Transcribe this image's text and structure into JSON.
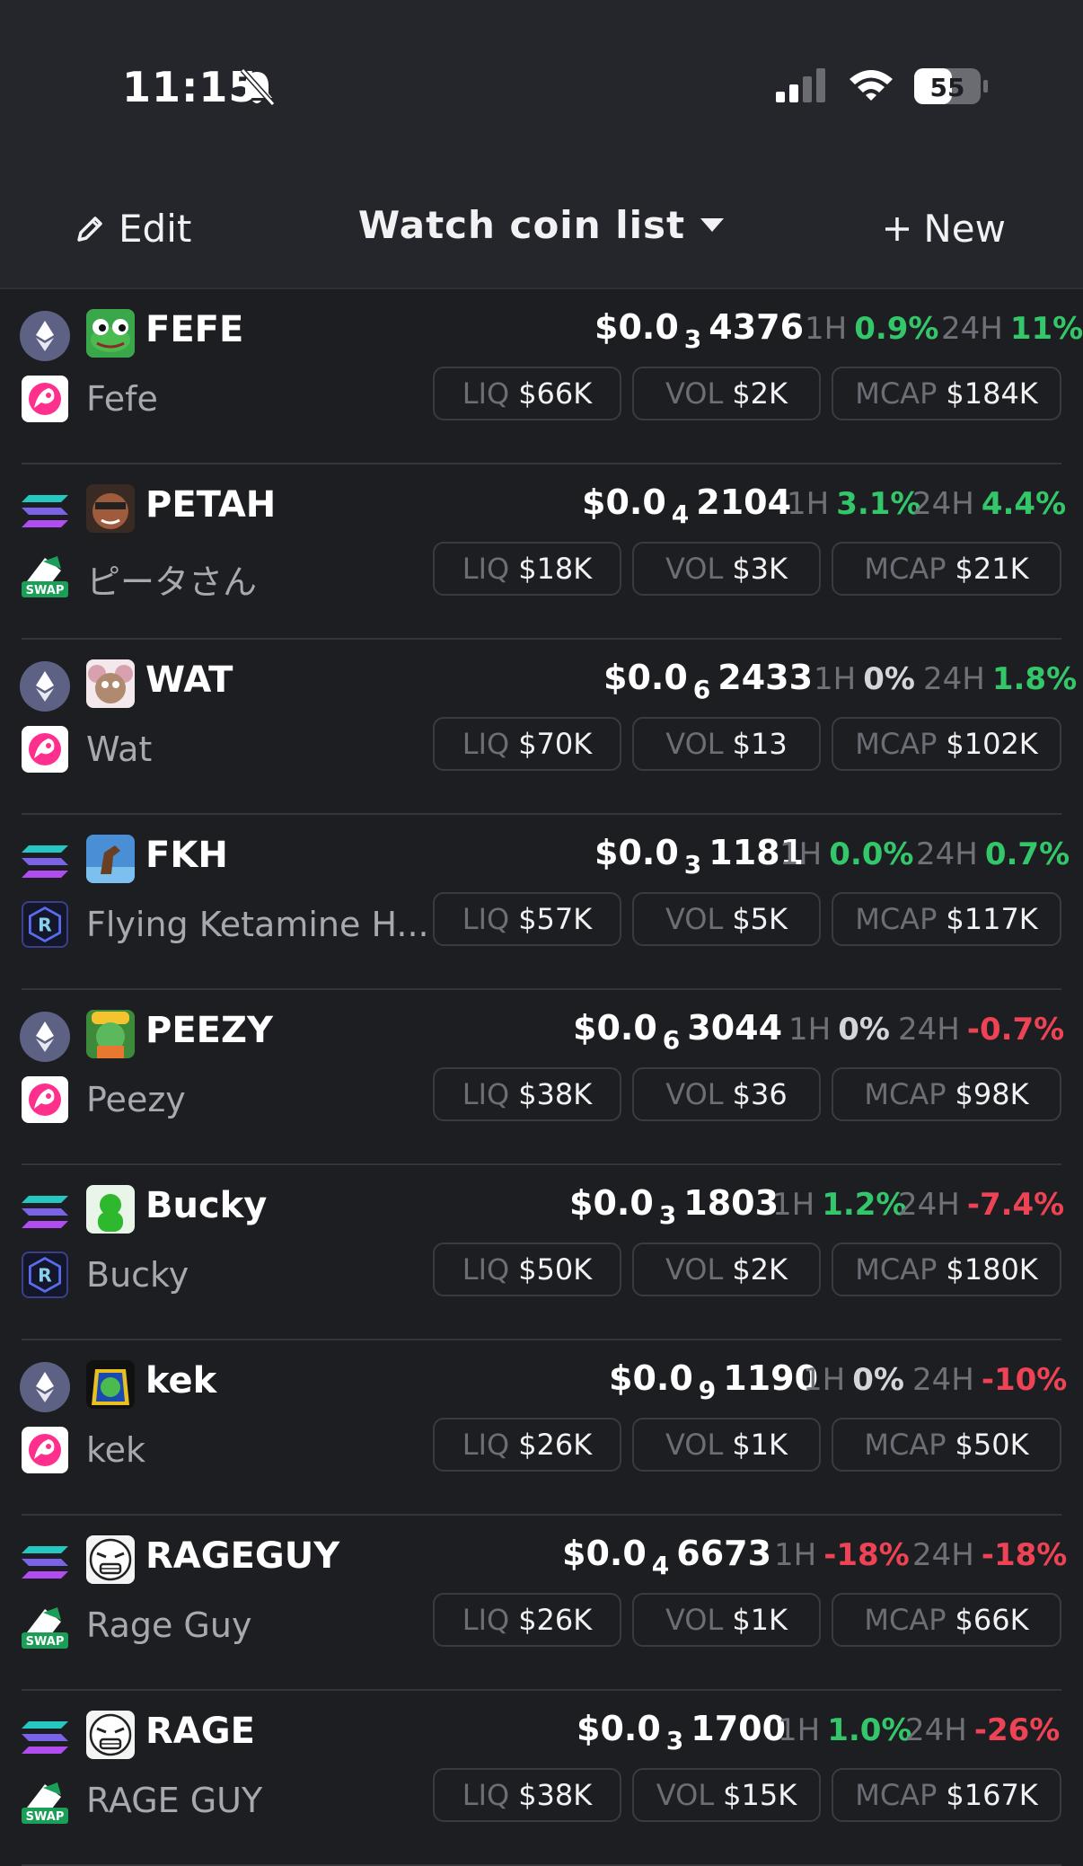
{
  "status_bar": {
    "time": "11:15",
    "battery": "55"
  },
  "header": {
    "edit_label": "Edit",
    "title": "Watch coin list",
    "new_label": "New"
  },
  "labels": {
    "liq": "LIQ",
    "vol": "VOL",
    "mcap": "MCAP",
    "h1": "1H",
    "h24": "24H"
  },
  "colors": {
    "positive": "#34c76a",
    "negative": "#ee4355",
    "background": "#1d1e22"
  },
  "coins": [
    {
      "symbol": "FEFE",
      "name": "Fefe",
      "chain": "ethereum",
      "dex": "uniswap",
      "price_prefix": "$0.0",
      "price_zeros": "3",
      "price_digits": "4376",
      "h1": "0.9%",
      "h1_dir": "pos",
      "h24": "11%",
      "h24_dir": "pos",
      "liq": "$66K",
      "vol": "$2K",
      "mcap": "$184K",
      "logo": "frog-icon"
    },
    {
      "symbol": "PETAH",
      "name": "ピータさん",
      "chain": "solana",
      "dex": "swap",
      "price_prefix": "$0.0",
      "price_zeros": "4",
      "price_digits": "2104",
      "h1": "3.1%",
      "h1_dir": "pos",
      "h24": "4.4%",
      "h24_dir": "pos",
      "liq": "$18K",
      "vol": "$3K",
      "mcap": "$21K",
      "logo": "face-icon"
    },
    {
      "symbol": "WAT",
      "name": "Wat",
      "chain": "ethereum",
      "dex": "uniswap",
      "price_prefix": "$0.0",
      "price_zeros": "6",
      "price_digits": "2433",
      "h1": "0%",
      "h1_dir": "zero",
      "h24": "1.8%",
      "h24_dir": "pos",
      "liq": "$70K",
      "vol": "$13",
      "mcap": "$102K",
      "logo": "mouse-icon"
    },
    {
      "symbol": "FKH",
      "name": "Flying Ketamine H...",
      "chain": "solana",
      "dex": "raydium",
      "price_prefix": "$0.0",
      "price_zeros": "3",
      "price_digits": "1181",
      "h1": "0.0%",
      "h1_dir": "pos",
      "h24": "0.7%",
      "h24_dir": "pos",
      "liq": "$57K",
      "vol": "$5K",
      "mcap": "$117K",
      "logo": "horse-icon"
    },
    {
      "symbol": "PEEZY",
      "name": "Peezy",
      "chain": "ethereum",
      "dex": "uniswap",
      "price_prefix": "$0.0",
      "price_zeros": "6",
      "price_digits": "3044",
      "h1": "0%",
      "h1_dir": "zero",
      "h24": "-0.7%",
      "h24_dir": "neg",
      "liq": "$38K",
      "vol": "$36",
      "mcap": "$98K",
      "logo": "frog-hat-icon"
    },
    {
      "symbol": "Bucky",
      "name": "Bucky",
      "chain": "solana",
      "dex": "raydium",
      "price_prefix": "$0.0",
      "price_zeros": "3",
      "price_digits": "1803",
      "h1": "1.2%",
      "h1_dir": "pos",
      "h24": "-7.4%",
      "h24_dir": "neg",
      "liq": "$50K",
      "vol": "$2K",
      "mcap": "$180K",
      "logo": "green-frog-icon"
    },
    {
      "symbol": "kek",
      "name": "kek",
      "chain": "ethereum",
      "dex": "uniswap",
      "price_prefix": "$0.0",
      "price_zeros": "9",
      "price_digits": "1190",
      "h1": "0%",
      "h1_dir": "zero",
      "h24": "-10%",
      "h24_dir": "neg",
      "liq": "$26K",
      "vol": "$1K",
      "mcap": "$50K",
      "logo": "pharaoh-frog-icon"
    },
    {
      "symbol": "RAGEGUY",
      "name": "Rage Guy",
      "chain": "solana",
      "dex": "swap",
      "price_prefix": "$0.0",
      "price_zeros": "4",
      "price_digits": "6673",
      "h1": "-18%",
      "h1_dir": "neg",
      "h24": "-18%",
      "h24_dir": "neg",
      "liq": "$26K",
      "vol": "$1K",
      "mcap": "$66K",
      "logo": "rage-face-icon"
    },
    {
      "symbol": "RAGE",
      "name": "RAGE GUY",
      "chain": "solana",
      "dex": "swap",
      "price_prefix": "$0.0",
      "price_zeros": "3",
      "price_digits": "1700",
      "h1": "1.0%",
      "h1_dir": "pos",
      "h24": "-26%",
      "h24_dir": "neg",
      "liq": "$38K",
      "vol": "$15K",
      "mcap": "$167K",
      "logo": "rage-face-icon"
    }
  ]
}
